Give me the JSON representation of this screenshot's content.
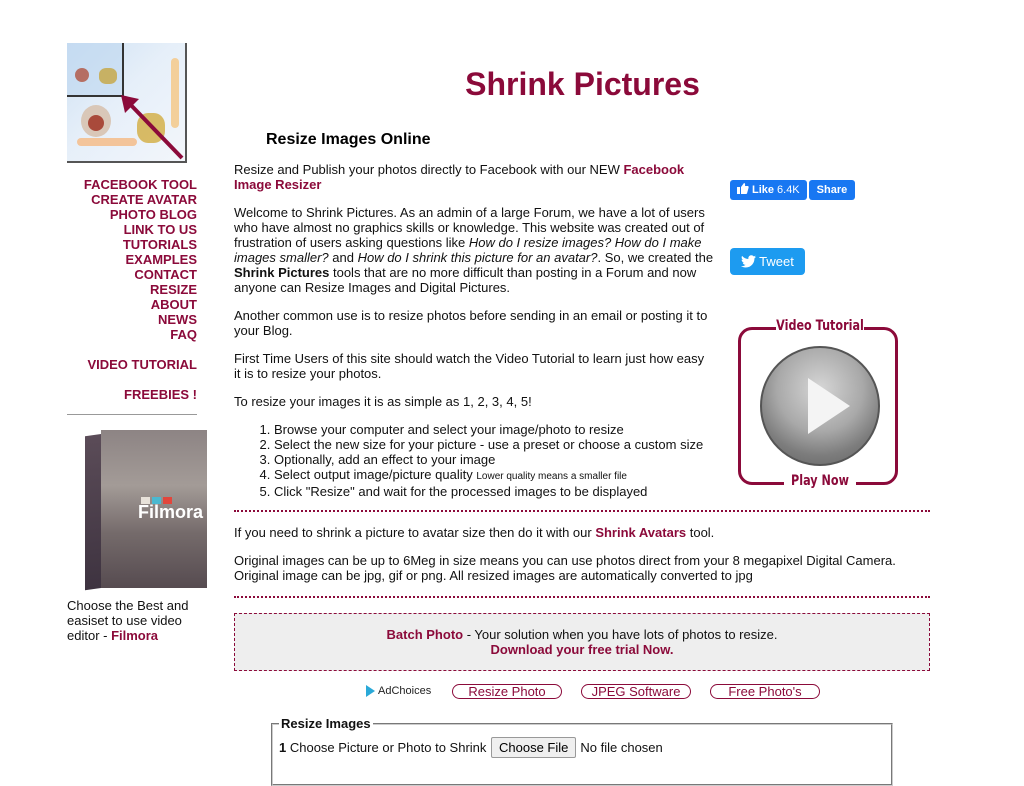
{
  "header": {
    "site_title": "Shrink Pictures",
    "subtitle": "Resize Images Online"
  },
  "sidebar": {
    "nav": [
      {
        "label": "FACEBOOK TOOL"
      },
      {
        "label": "CREATE AVATAR"
      },
      {
        "label": "PHOTO BLOG"
      },
      {
        "label": "LINK TO US"
      },
      {
        "label": "TUTORIALS"
      },
      {
        "label": "EXAMPLES"
      },
      {
        "label": "CONTACT"
      },
      {
        "label": "RESIZE"
      },
      {
        "label": "ABOUT"
      },
      {
        "label": "NEWS"
      },
      {
        "label": "FAQ"
      }
    ],
    "video_tutorial": "VIDEO TUTORIAL",
    "freebies": "FREEBIES !",
    "ad": {
      "product_name": "Filmora",
      "caption": "Choose the Best and easiset to use video editor - ",
      "link": "Filmora"
    }
  },
  "intro": {
    "facebook_text": "Resize and Publish your photos directly to Facebook with our NEW ",
    "facebook_link": "Facebook Image Resizer",
    "welcome_1": "Welcome to Shrink Pictures.  As an admin of a large Forum, we have a lot of users who have almost no graphics skills or knowledge.  This website was created out of frustration of users asking questions like ",
    "welcome_q1": "How do I resize images? How do I make images smaller?",
    "welcome_and": " and ",
    "welcome_q2": "How do I shrink this picture for an avatar?",
    "welcome_2": ".  So, we created the ",
    "welcome_brand": "Shrink Pictures",
    "welcome_3": " tools that are no more difficult than posting in a Forum and now anyone can Resize Images and Digital Pictures.",
    "common_use": "Another common use is to resize photos before sending in an email or posting it to your Blog.",
    "first_time": "First Time Users of this site should watch the Video Tutorial to learn just how easy it is to resize your photos.",
    "simple": "To resize your images it is as simple as 1, 2, 3, 4, 5!",
    "steps": [
      "Browse your computer and select your image/photo to resize",
      "Select the new size for your picture - use a preset or choose a custom size",
      "Optionally, add an effect to your image",
      "Select output image/picture quality ",
      "Click \"Resize\" and wait for the processed images to be displayed"
    ],
    "step4_note": "Lower quality means a smaller file"
  },
  "social": {
    "like_label": "Like",
    "like_count": "6.4K",
    "share_label": "Share",
    "tweet_label": "Tweet"
  },
  "video_box": {
    "top_label": "Video Tutorial",
    "bottom_label": "Play Now"
  },
  "lower": {
    "avatar_text_1": "If you need to shrink a picture to avatar size then do it with our ",
    "avatar_link": "Shrink Avatars",
    "avatar_text_2": " tool.",
    "orig_line1": "Original images can be up to 6Meg in size means you can use photos direct from your 8 megapixel Digital Camera.",
    "orig_line2": "Original image can be jpg, gif or png. All resized images are automatically converted to jpg",
    "batch_link": "Batch Photo",
    "batch_text": " - Your solution when you have lots of photos to resize.",
    "download_link": "Download your free trial Now."
  },
  "ads": {
    "adchoices": "AdChoices",
    "pills": [
      "Resize Photo",
      "JPEG Software",
      "Free Photo's"
    ]
  },
  "form": {
    "legend": "Resize Images",
    "step_num": "1",
    "step_label": " Choose Picture or Photo to Shrink ",
    "choose_file": "Choose File",
    "no_file": "No file chosen"
  },
  "colors": {
    "accent": "#8b0a3a",
    "facebook": "#1877f2",
    "twitter": "#1d9bf0",
    "batch_bg": "#eeeeee"
  }
}
